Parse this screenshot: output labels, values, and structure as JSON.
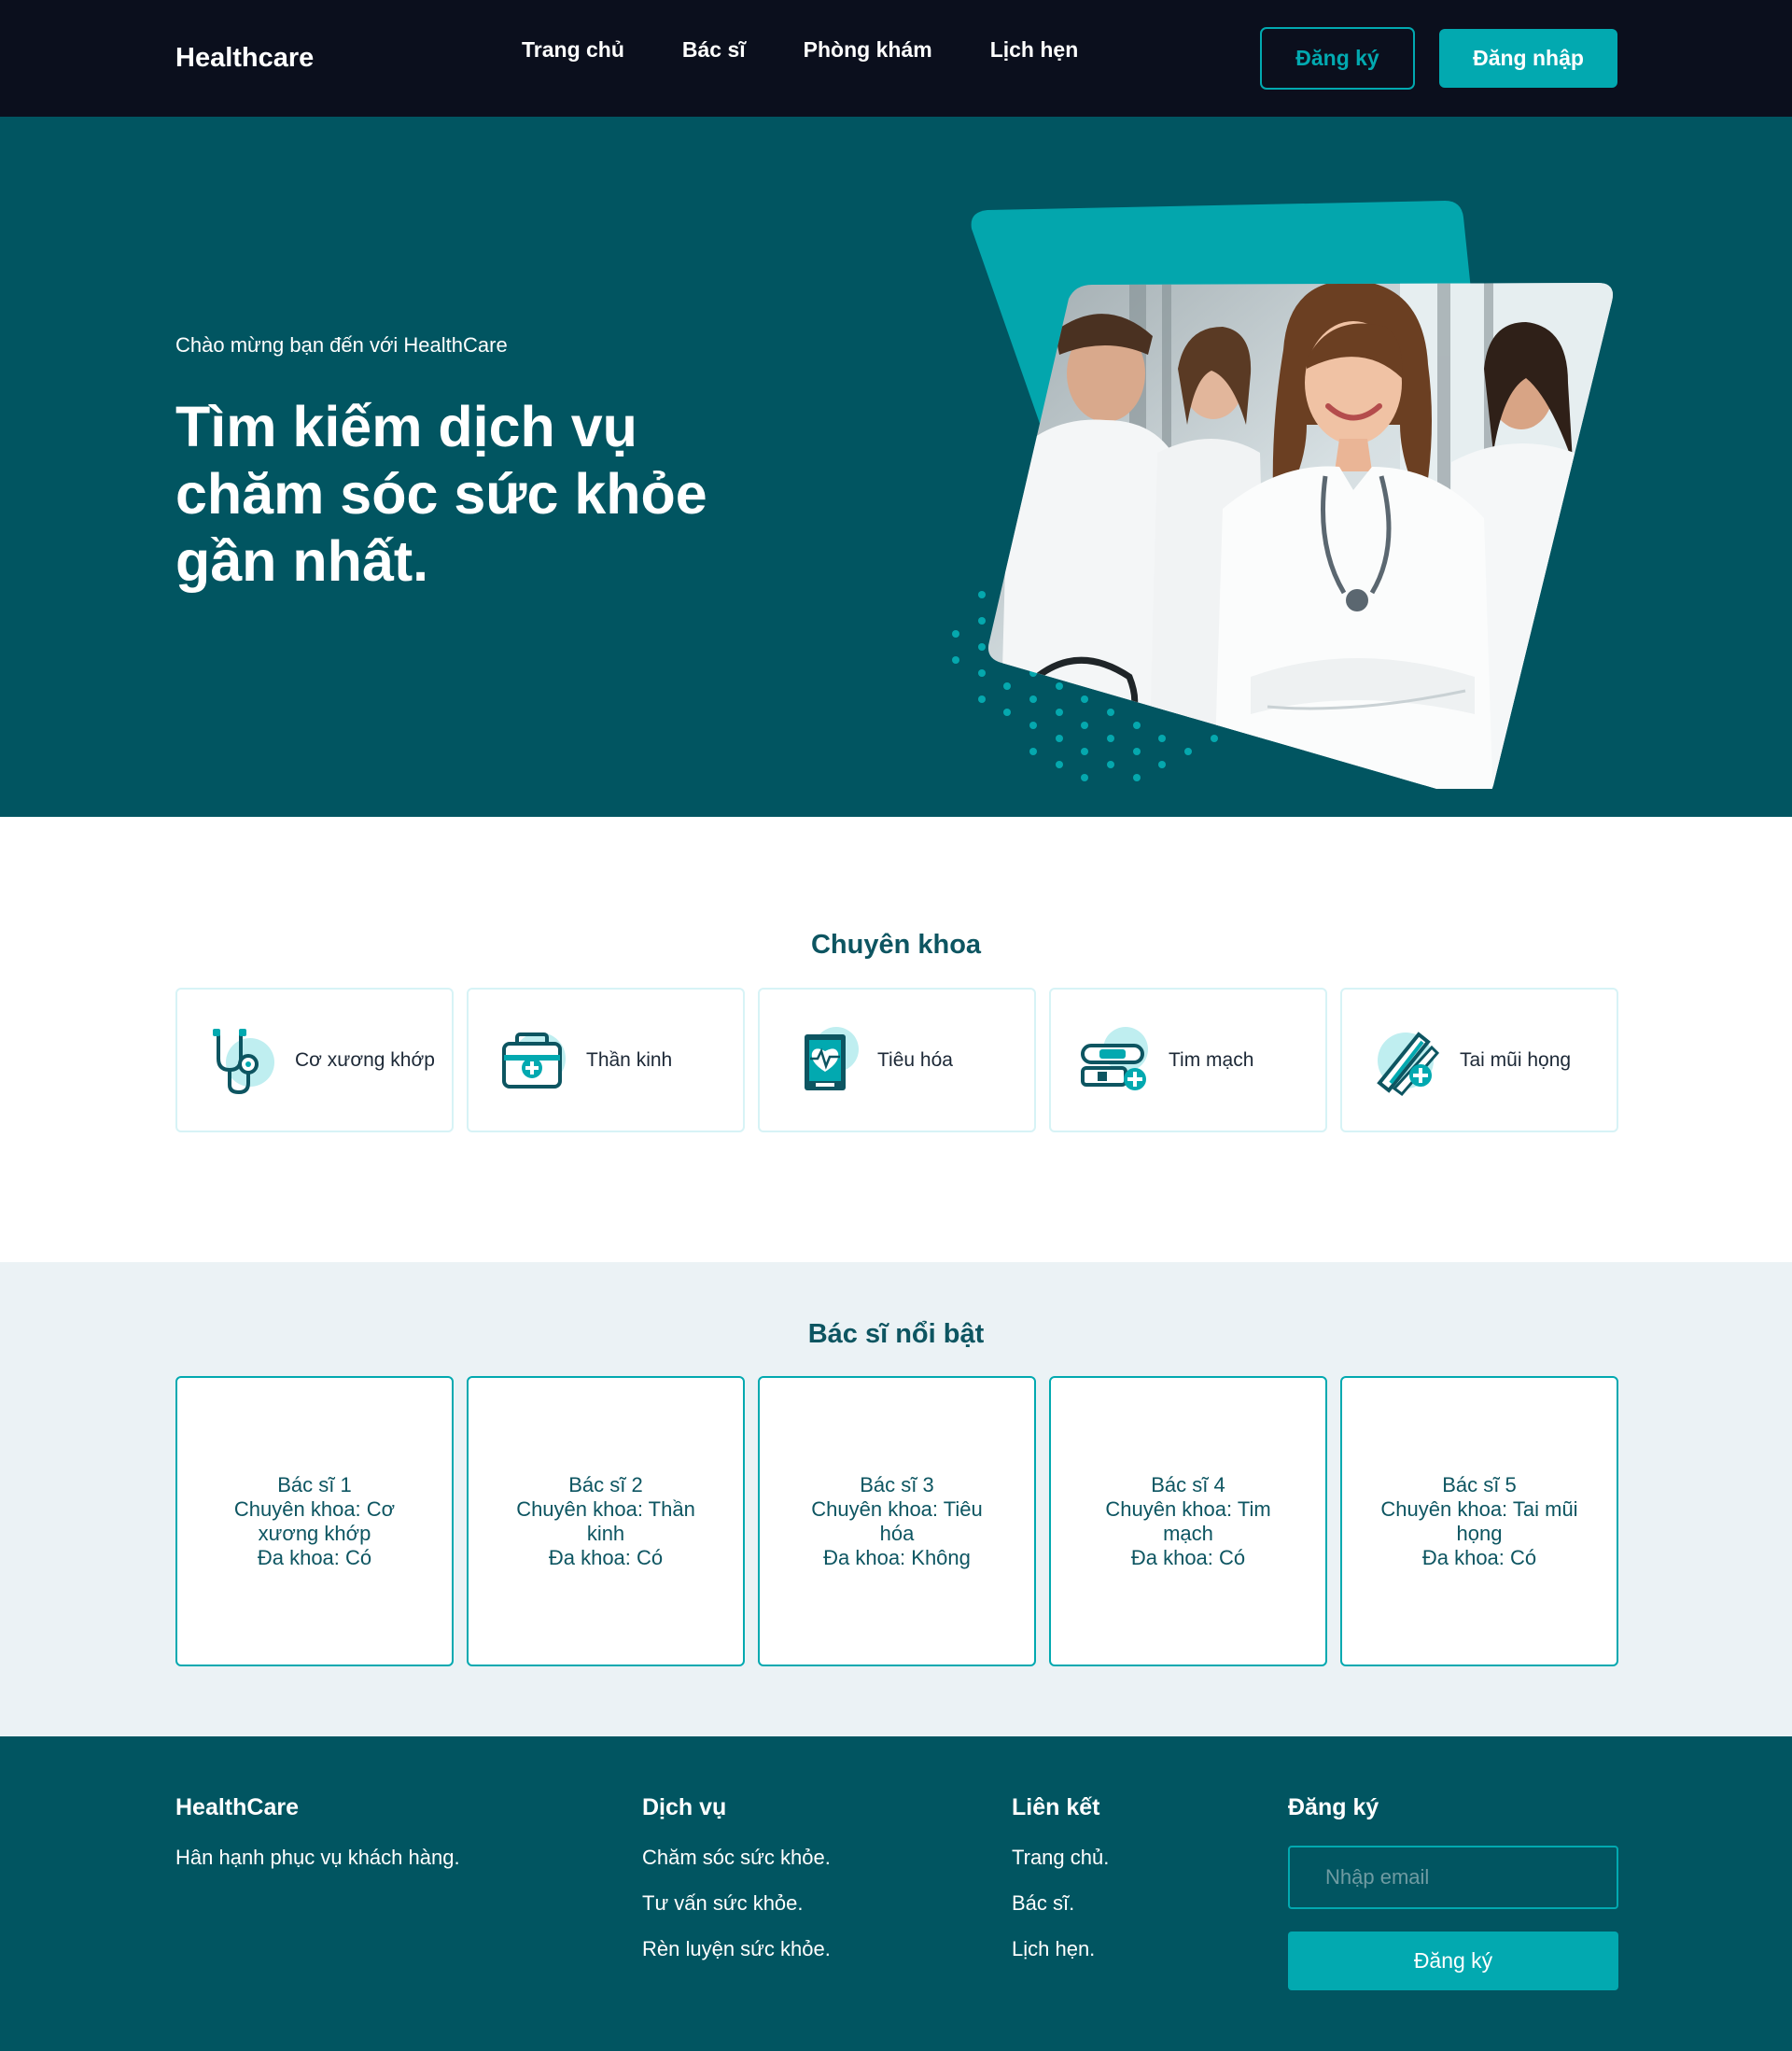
{
  "nav": {
    "brand": "Healthcare",
    "links": [
      "Trang chủ",
      "Bác sĩ",
      "Phòng khám",
      "Lịch hẹn"
    ],
    "register": "Đăng ký",
    "login": "Đăng nhập"
  },
  "hero": {
    "welcome": "Chào mừng bạn đến với HealthCare",
    "headline": "Tìm kiếm dịch vụ chăm sóc sức khỏe gần nhất."
  },
  "specialties": {
    "title": "Chuyên khoa",
    "items": [
      {
        "label": "Cơ xương khớp",
        "icon": "stethoscope-icon"
      },
      {
        "label": "Thần kinh",
        "icon": "medical-kit-icon"
      },
      {
        "label": "Tiêu hóa",
        "icon": "heart-monitor-icon"
      },
      {
        "label": "Tim mạch",
        "icon": "pills-icon"
      },
      {
        "label": "Tai mũi họng",
        "icon": "thermometer-icon"
      }
    ]
  },
  "doctors": {
    "title": "Bác sĩ nổi bật",
    "items": [
      {
        "name": "Bác sĩ 1",
        "specialty": "Chuyên khoa: Cơ xương khớp",
        "general": "Đa khoa: Có"
      },
      {
        "name": "Bác sĩ 2",
        "specialty": "Chuyên khoa: Thần kinh",
        "general": "Đa khoa: Có"
      },
      {
        "name": "Bác sĩ 3",
        "specialty": "Chuyên khoa: Tiêu hóa",
        "general": "Đa khoa: Không"
      },
      {
        "name": "Bác sĩ 4",
        "specialty": "Chuyên khoa: Tim mạch",
        "general": "Đa khoa: Có"
      },
      {
        "name": "Bác sĩ 5",
        "specialty": "Chuyên khoa: Tai mũi họng",
        "general": "Đa khoa: Có"
      }
    ]
  },
  "footer": {
    "brand": {
      "title": "HealthCare",
      "tagline": "Hân hạnh phục vụ khách hàng."
    },
    "services": {
      "title": "Dịch vụ",
      "items": [
        "Chăm sóc sức khỏe.",
        "Tư vấn sức khỏe.",
        "Rèn luyện sức khỏe."
      ]
    },
    "links": {
      "title": "Liên kết",
      "items": [
        "Trang chủ.",
        "Bác sĩ.",
        "Lịch hẹn."
      ]
    },
    "subscribe": {
      "title": "Đăng ký",
      "placeholder": "Nhập email",
      "button": "Đăng ký"
    }
  },
  "colors": {
    "nav": "#0b0f1d",
    "hero": "#015561",
    "accent": "#02a9b0",
    "section_bg": "#ebf2f5"
  }
}
